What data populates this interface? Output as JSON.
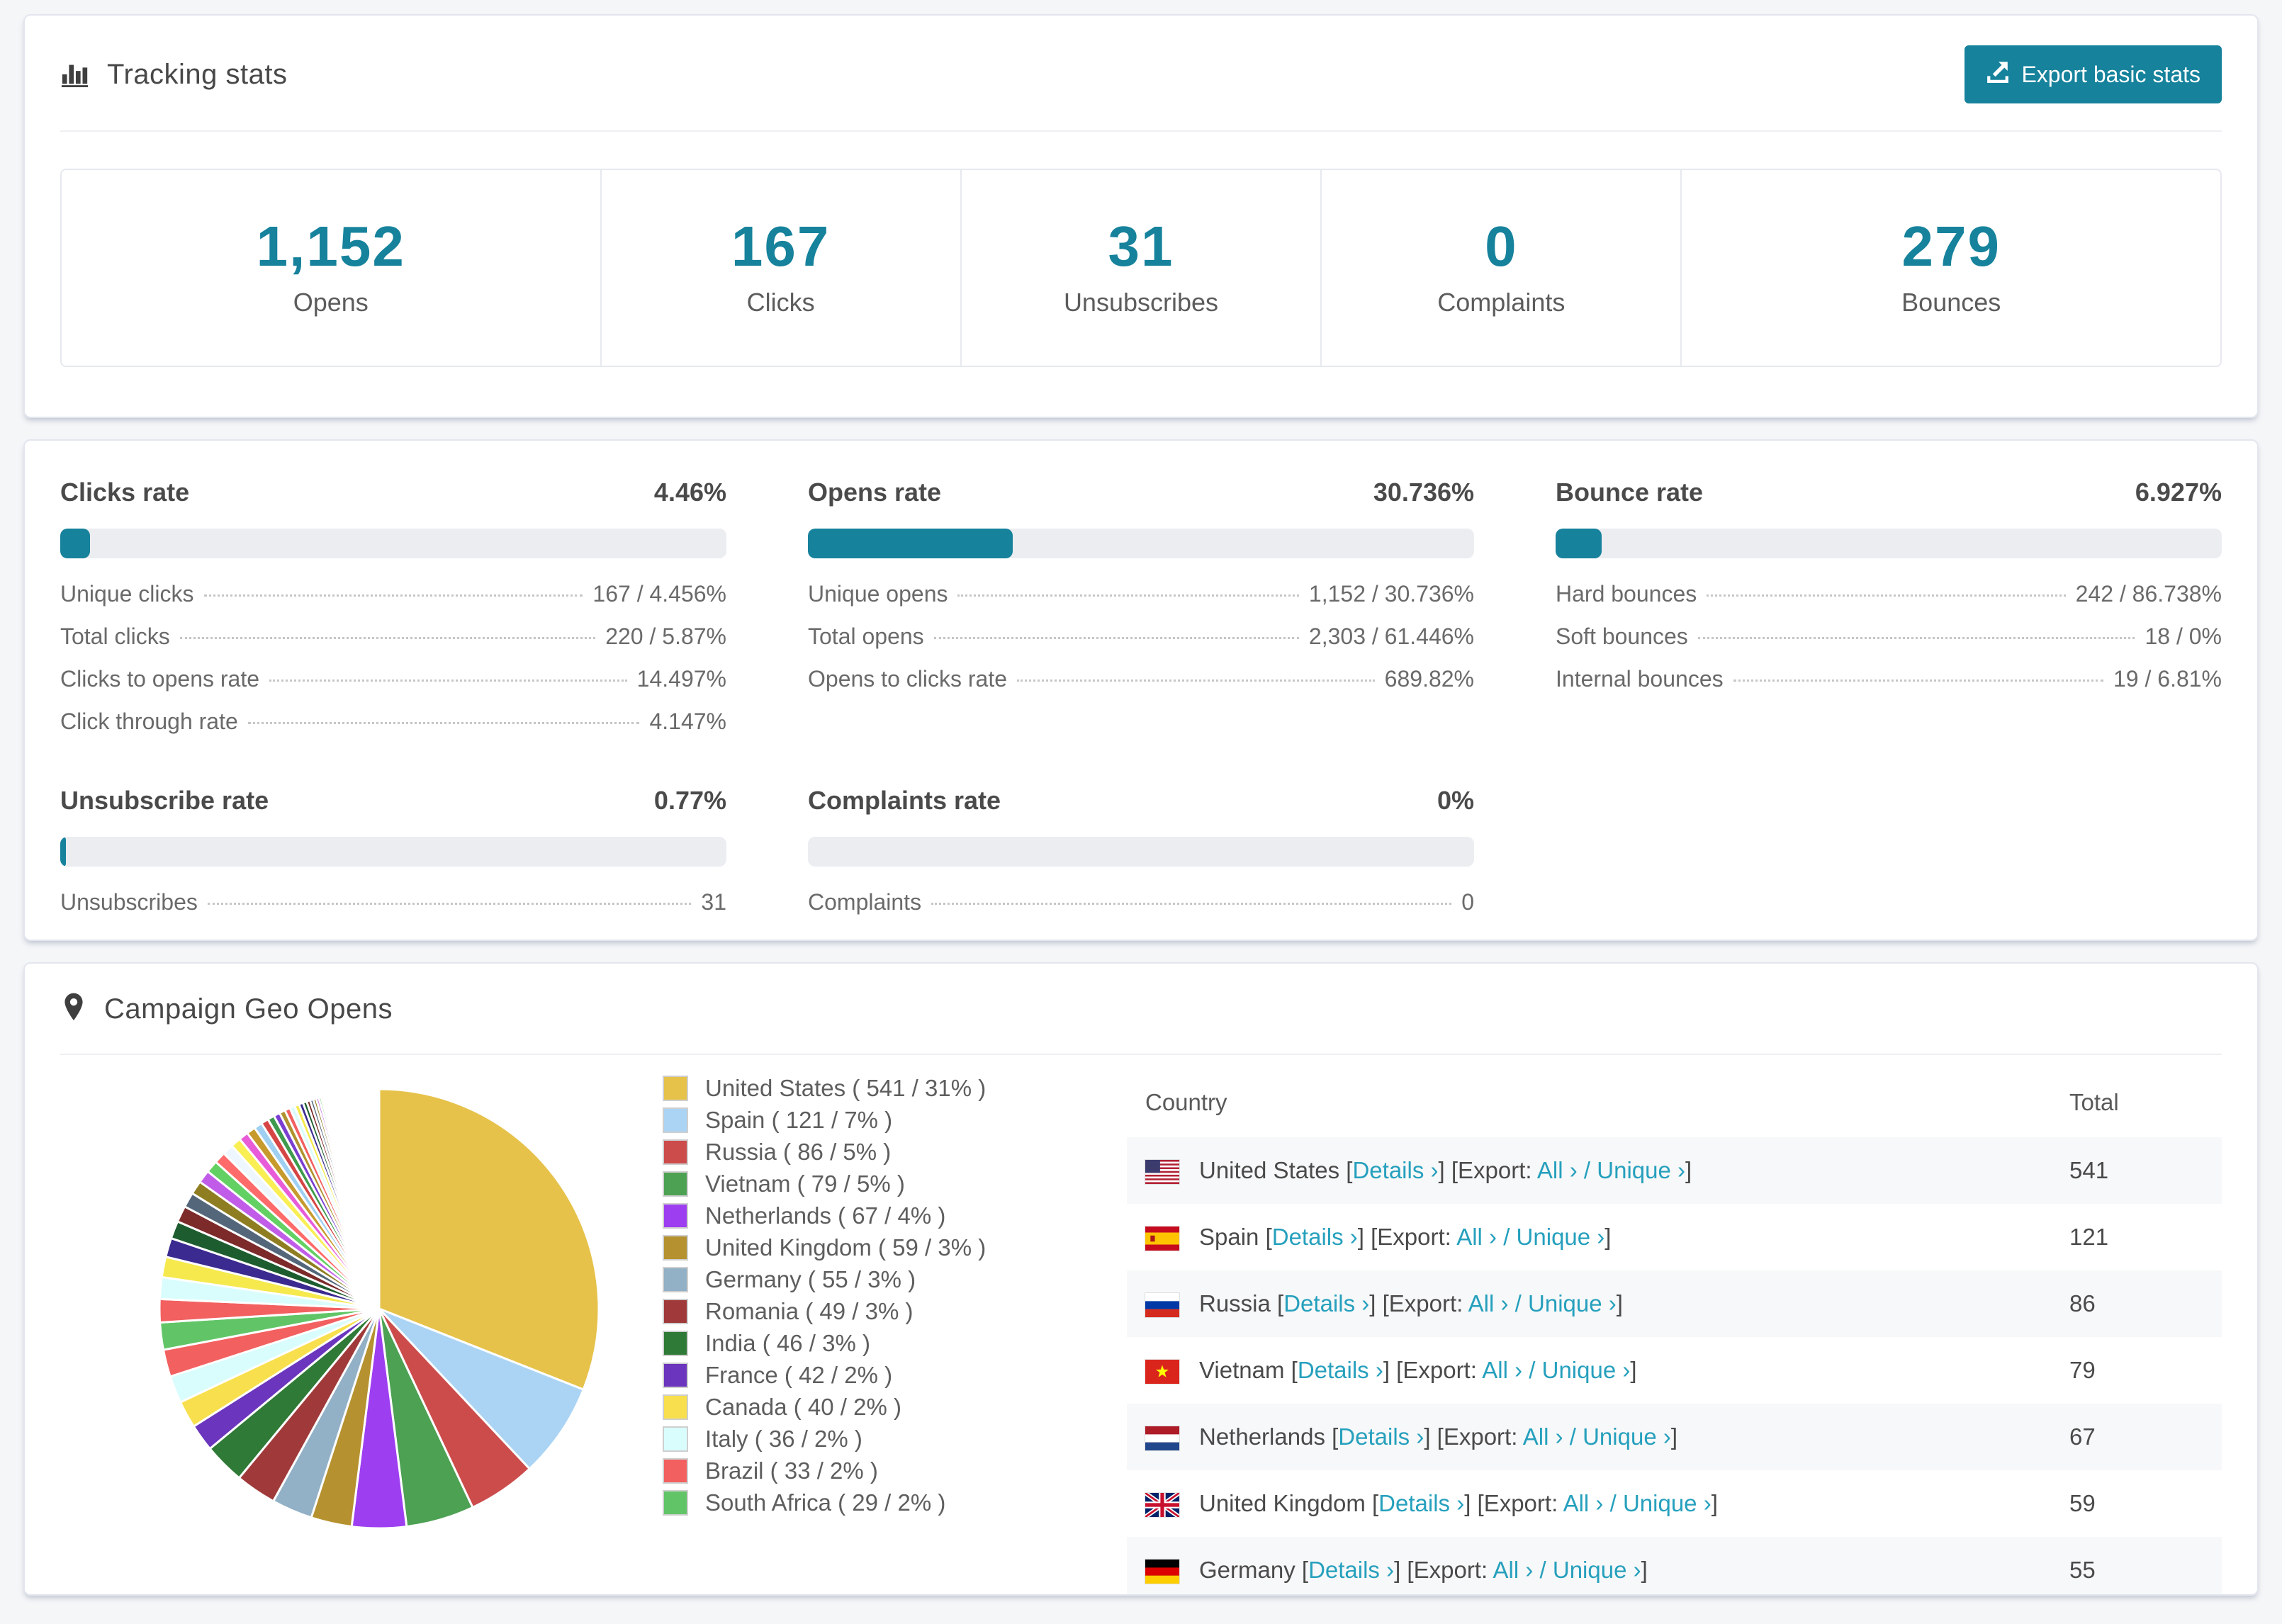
{
  "colors": {
    "accent": "#16829c",
    "link": "#26a0bd"
  },
  "header": {
    "title": "Tracking stats",
    "export_label": "Export basic stats"
  },
  "summary_stats": [
    {
      "value": "1,152",
      "label": "Opens"
    },
    {
      "value": "167",
      "label": "Clicks"
    },
    {
      "value": "31",
      "label": "Unsubscribes"
    },
    {
      "value": "0",
      "label": "Complaints"
    },
    {
      "value": "279",
      "label": "Bounces"
    }
  ],
  "rate_blocks": [
    {
      "title": "Clicks rate",
      "value": "4.46%",
      "pct": 4.46,
      "rows": [
        {
          "label": "Unique clicks",
          "value": "167 / 4.456%"
        },
        {
          "label": "Total clicks",
          "value": "220 / 5.87%"
        },
        {
          "label": "Clicks to opens rate",
          "value": "14.497%"
        },
        {
          "label": "Click through rate",
          "value": "4.147%"
        }
      ]
    },
    {
      "title": "Opens rate",
      "value": "30.736%",
      "pct": 30.736,
      "rows": [
        {
          "label": "Unique opens",
          "value": "1,152 / 30.736%"
        },
        {
          "label": "Total opens",
          "value": "2,303 / 61.446%"
        },
        {
          "label": "Opens to clicks rate",
          "value": "689.82%"
        }
      ]
    },
    {
      "title": "Bounce rate",
      "value": "6.927%",
      "pct": 6.927,
      "rows": [
        {
          "label": "Hard bounces",
          "value": "242 / 86.738%"
        },
        {
          "label": "Soft bounces",
          "value": "18 / 0%"
        },
        {
          "label": "Internal bounces",
          "value": "19 / 6.81%"
        }
      ]
    },
    {
      "title": "Unsubscribe rate",
      "value": "0.77%",
      "pct": 0.77,
      "rows": [
        {
          "label": "Unsubscribes",
          "value": "31"
        }
      ]
    },
    {
      "title": "Complaints rate",
      "value": "0%",
      "pct": 0,
      "rows": [
        {
          "label": "Complaints",
          "value": "0"
        }
      ]
    }
  ],
  "geo": {
    "title": "Campaign Geo Opens",
    "columns": {
      "country": "Country",
      "total": "Total"
    },
    "links": {
      "details_label": "Details",
      "export_label": "Export:",
      "all_label": "All",
      "unique_label": "Unique",
      "chevron": "›"
    },
    "rows": [
      {
        "name": "United States",
        "flag": "us",
        "total": "541"
      },
      {
        "name": "Spain",
        "flag": "es",
        "total": "121"
      },
      {
        "name": "Russia",
        "flag": "ru",
        "total": "86"
      },
      {
        "name": "Vietnam",
        "flag": "vn",
        "total": "79"
      },
      {
        "name": "Netherlands",
        "flag": "nl",
        "total": "67"
      },
      {
        "name": "United Kingdom",
        "flag": "gb",
        "total": "59"
      },
      {
        "name": "Germany",
        "flag": "de",
        "total": "55"
      }
    ]
  },
  "chart_data": {
    "type": "pie",
    "title": "Campaign Geo Opens",
    "legend_position": "right",
    "start_angle_deg": 0,
    "slices": [
      {
        "label": "United States",
        "value": 541,
        "pct": 31,
        "color": "#e6c24a"
      },
      {
        "label": "Spain",
        "value": 121,
        "pct": 7,
        "color": "#abd4f4"
      },
      {
        "label": "Russia",
        "value": 86,
        "pct": 5,
        "color": "#cc4c4c"
      },
      {
        "label": "Vietnam",
        "value": 79,
        "pct": 5,
        "color": "#4da153"
      },
      {
        "label": "Netherlands",
        "value": 67,
        "pct": 4,
        "color": "#9d3ff0"
      },
      {
        "label": "United Kingdom",
        "value": 59,
        "pct": 3,
        "color": "#b5922f"
      },
      {
        "label": "Germany",
        "value": 55,
        "pct": 3,
        "color": "#92b0c6"
      },
      {
        "label": "Romania",
        "value": 49,
        "pct": 3,
        "color": "#a03a3a"
      },
      {
        "label": "India",
        "value": 46,
        "pct": 3,
        "color": "#2f7a36"
      },
      {
        "label": "France",
        "value": 42,
        "pct": 2,
        "color": "#6b35bd"
      },
      {
        "label": "Canada",
        "value": 40,
        "pct": 2,
        "color": "#f8df4d"
      },
      {
        "label": "Italy",
        "value": 36,
        "pct": 2,
        "color": "#d9fdfc"
      },
      {
        "label": "Brazil",
        "value": 33,
        "pct": 2,
        "color": "#f26060"
      },
      {
        "label": "South Africa",
        "value": 29,
        "pct": 2,
        "color": "#61c567"
      }
    ],
    "others_pct": [
      1.7,
      1.6,
      1.5,
      1.4,
      1.3,
      1.2,
      1.1,
      1.0,
      0.95,
      0.9,
      0.85,
      0.8,
      0.75,
      0.7,
      0.65,
      0.6,
      0.55,
      0.5,
      0.46,
      0.43,
      0.4,
      0.37,
      0.34,
      0.31,
      0.28,
      0.26,
      0.24,
      0.22,
      0.2,
      0.18,
      0.16,
      0.15,
      0.14,
      0.13,
      0.12,
      0.11,
      0.1,
      0.09,
      0.08,
      0.08,
      0.07,
      0.07,
      0.06,
      0.06,
      0.05,
      0.05,
      0.04,
      0.04
    ],
    "others_palette": [
      "#f26060",
      "#d9fdfc",
      "#f5e94e",
      "#3b2a8f",
      "#1d5c2e",
      "#7c2a2a",
      "#54677a",
      "#8f7d22",
      "#c05ce8",
      "#63d063",
      "#ff6b6b",
      "#eef7ff",
      "#f9ef55",
      "#e85cd8",
      "#c79a2d",
      "#9fd0f2",
      "#d64545",
      "#3f9a4d",
      "#7a3fd0",
      "#b0922f"
    ]
  }
}
